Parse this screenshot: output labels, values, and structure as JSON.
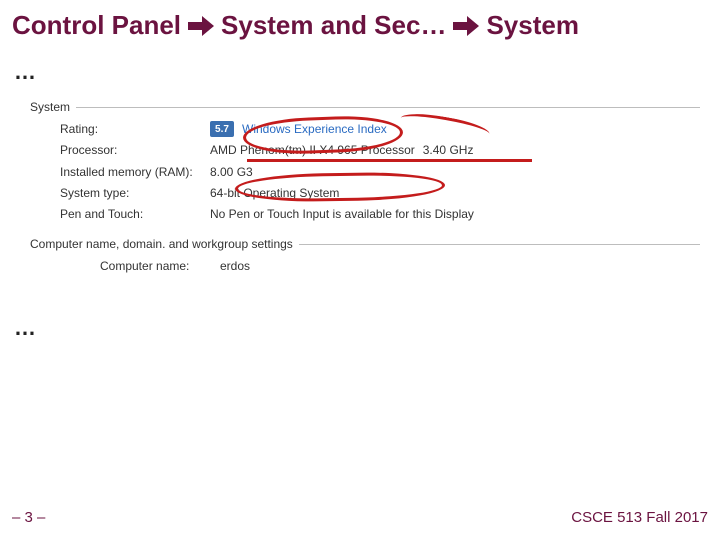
{
  "title": {
    "p1": "Control Panel",
    "p2": "System and Sec…",
    "p3": "System"
  },
  "ellipsis_top": "…",
  "ellipsis_bottom": "…",
  "sections": {
    "system": {
      "header": "System",
      "rating": {
        "label": "Rating:",
        "badge": "5.7",
        "link": "Windows Experience Index"
      },
      "processor": {
        "label": "Processor:",
        "value": "AMD Phenom(tm) II X4 965 Processor",
        "speed": "3.40 GHz"
      },
      "ram": {
        "label": "Installed memory (RAM):",
        "value": "8.00 G3"
      },
      "type": {
        "label": "System type:",
        "value": "64-bit Operating System"
      },
      "pen": {
        "label": "Pen and Touch:",
        "value": "No Pen or Touch Input is available for this Display"
      }
    },
    "computer": {
      "header": "Computer name, domain. and workgroup settings",
      "name": {
        "label": "Computer name:",
        "value": "erdos"
      }
    }
  },
  "footer": {
    "page": "– 3 –",
    "course": "CSCE 513 Fall 2017"
  }
}
